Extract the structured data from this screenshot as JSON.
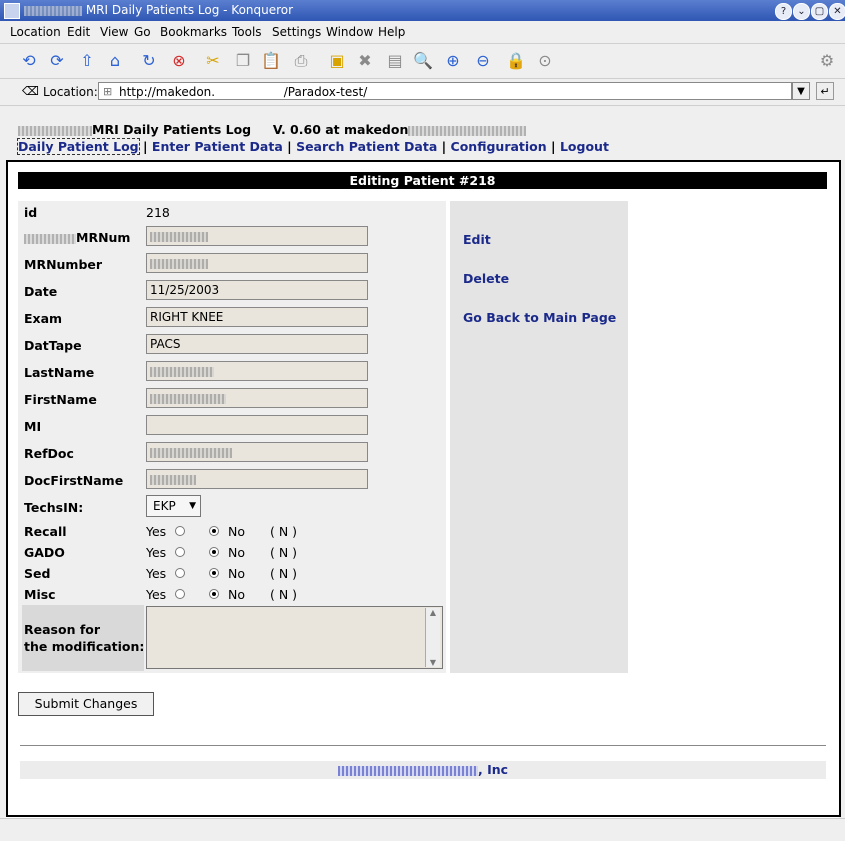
{
  "window": {
    "title": "MRI Daily Patients Log - Konqueror",
    "buttons": [
      "?",
      "⌄",
      "▢",
      "✕"
    ]
  },
  "menubar": {
    "items": [
      "Location",
      "Edit",
      "View",
      "Go",
      "Bookmarks",
      "Tools",
      "Settings",
      "Window",
      "Help"
    ]
  },
  "toolbar": {
    "icons": [
      "back-icon",
      "forward-icon",
      "up-icon",
      "home-icon",
      "reload-icon",
      "stop-icon",
      "cut-icon",
      "copy-icon",
      "paste-icon",
      "print-icon",
      "new-folder-icon",
      "delete-icon",
      "print-preview-icon",
      "zoom-icon",
      "zoom-in-icon",
      "zoom-out-icon",
      "lock-icon",
      "download-icon"
    ]
  },
  "location": {
    "label": "Location:",
    "url": "http://makedon.                  /Paradox-test/"
  },
  "header": {
    "app_name": "MRI Daily Patients Log",
    "version": "V. 0.60 at makedon"
  },
  "nav": {
    "items": [
      "Daily Patient Log",
      "Enter Patient Data",
      "Search Patient Data",
      "Configuration",
      "Logout"
    ],
    "separator": "|"
  },
  "form": {
    "heading": "Editing Patient #218",
    "id_label": "id",
    "id_value": "218",
    "fields": {
      "mrnum": {
        "label": "MRNum",
        "value": ""
      },
      "mrnumber": {
        "label": "MRNumber",
        "value": ""
      },
      "date": {
        "label": "Date",
        "value": "11/25/2003"
      },
      "exam": {
        "label": "Exam",
        "value": "RIGHT KNEE"
      },
      "dattape": {
        "label": "DatTape",
        "value": "PACS"
      },
      "lastname": {
        "label": "LastName",
        "value": ""
      },
      "firstname": {
        "label": "FirstName",
        "value": ""
      },
      "mi": {
        "label": "MI",
        "value": ""
      },
      "refdoc": {
        "label": "RefDoc",
        "value": ""
      },
      "docfirstname": {
        "label": "DocFirstName",
        "value": ""
      }
    },
    "techsin": {
      "label": "TechsIN:",
      "value": "EKP"
    },
    "radios": [
      {
        "label": "Recall",
        "yes": "Yes",
        "no": "No",
        "note": "( N )"
      },
      {
        "label": "GADO",
        "yes": "Yes",
        "no": "No",
        "note": "( N )"
      },
      {
        "label": "Sed",
        "yes": "Yes",
        "no": "No",
        "note": "( N )"
      },
      {
        "label": "Misc",
        "yes": "Yes",
        "no": "No",
        "note": "( N )"
      }
    ],
    "reason_label_1": "Reason for",
    "reason_label_2": "the modification:",
    "submit": "Submit Changes"
  },
  "actions": {
    "edit": "Edit",
    "delete": "Delete",
    "back": "Go Back to Main Page"
  },
  "footer": {
    "text": ", Inc"
  },
  "colors": {
    "titlebar": "#3a62c0",
    "link": "#1b2a8a",
    "field_bg": "#e9e5dc",
    "heading_bg": "#000000"
  }
}
